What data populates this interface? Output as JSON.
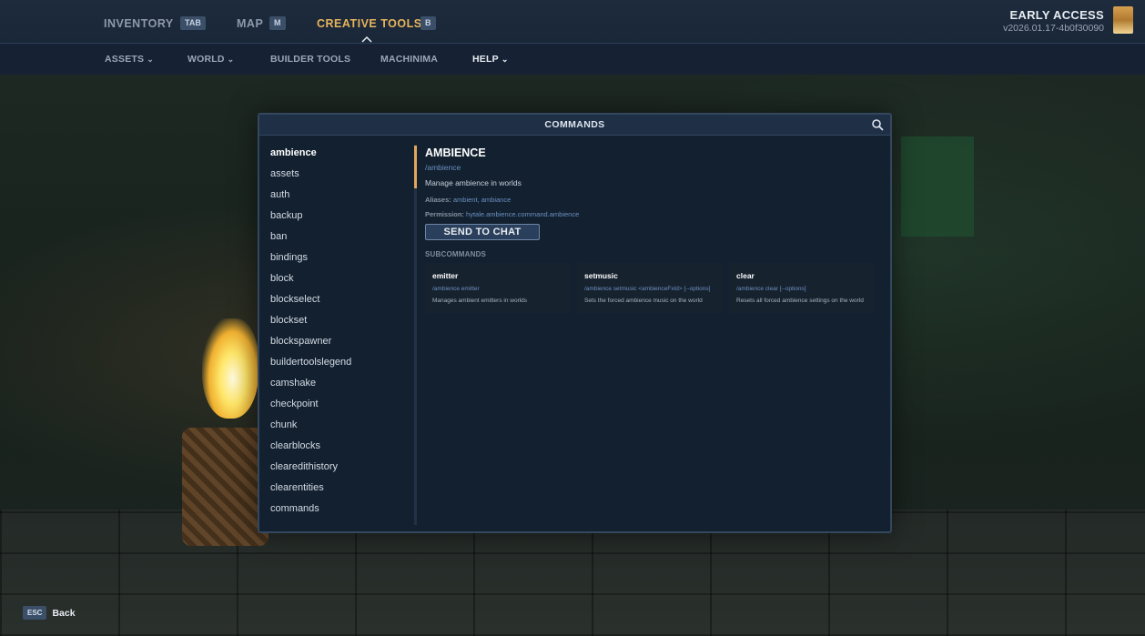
{
  "top_nav": {
    "tabs": [
      {
        "label": "INVENTORY",
        "key": "TAB",
        "active": false
      },
      {
        "label": "MAP",
        "key": "M",
        "active": false
      },
      {
        "label": "CREATIVE TOOLS",
        "key": "B",
        "active": true
      }
    ],
    "early_access": "EARLY ACCESS",
    "version": "v2026.01.17-4b0f30090"
  },
  "sub_nav": {
    "items": [
      {
        "label": "ASSETS",
        "dropdown": true
      },
      {
        "label": "WORLD",
        "dropdown": true
      },
      {
        "label": "BUILDER TOOLS",
        "dropdown": false
      },
      {
        "label": "MACHINIMA",
        "dropdown": false
      },
      {
        "label": "HELP",
        "dropdown": true
      }
    ],
    "chevron": "⌄"
  },
  "modal": {
    "title": "COMMANDS",
    "commands": [
      "ambience",
      "assets",
      "auth",
      "backup",
      "ban",
      "bindings",
      "block",
      "blockselect",
      "blockset",
      "blockspawner",
      "buildertoolslegend",
      "camshake",
      "checkpoint",
      "chunk",
      "clearblocks",
      "clearedithistory",
      "clearentities",
      "commands"
    ],
    "selected_command": "ambience",
    "detail": {
      "title": "AMBIENCE",
      "command": "/ambience",
      "description": "Manage ambience in worlds",
      "aliases_label": "Aliases:",
      "aliases": "ambient, ambiance",
      "permission_label": "Permission:",
      "permission": "hytale.ambience.command.ambience",
      "send_button": "SEND TO CHAT",
      "subcommands_label": "SUBCOMMANDS",
      "subcommands": [
        {
          "name": "emitter",
          "usage": "/ambience emitter",
          "description": "Manages ambient emitters in worlds"
        },
        {
          "name": "setmusic",
          "usage": "/ambience setmusic <ambienceFxId> [--options]",
          "description": "Sets the forced ambience music on the world"
        },
        {
          "name": "clear",
          "usage": "/ambience clear [--options]",
          "description": "Resets all forced ambience settings on the world"
        }
      ]
    }
  },
  "footer": {
    "key": "ESC",
    "label": "Back"
  },
  "colors": {
    "accent": "#e5a55a",
    "active_tab": "#e7b45a",
    "link": "#6c91c2"
  }
}
